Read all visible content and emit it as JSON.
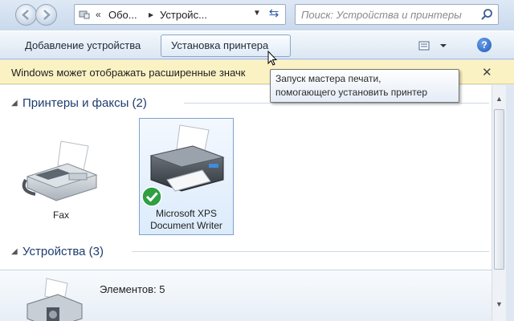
{
  "navigation": {
    "back_icon": "back-arrow-icon",
    "forward_icon": "forward-arrow-icon"
  },
  "address_bar": {
    "separator": "«",
    "crumb_1": "Обо...",
    "crumb_sep": "▶",
    "crumb_2": "Устройс...",
    "dropdown_icon": "chevron-down-icon",
    "refresh_icon": "refresh-icon"
  },
  "search": {
    "placeholder": "Поиск: Устройства и принтеры",
    "icon": "search-icon"
  },
  "toolbar": {
    "add_device_label": "Добавление устройства",
    "install_printer_label": "Установка принтера",
    "view_icon": "view-options-icon",
    "help_label": "?"
  },
  "infobar": {
    "message": "Windows может отображать расширенные значк",
    "close_label": "✕"
  },
  "tooltip": {
    "line_1": "Запуск мастера печати,",
    "line_2": "помогающего установить принтер"
  },
  "groups": [
    {
      "title": "Принтеры и факсы (2)",
      "devices": [
        {
          "label": "Fax",
          "icon": "fax-icon"
        },
        {
          "label_line_1": "Microsoft XPS",
          "label_line_2": "Document Writer",
          "icon": "printer-icon",
          "badge": "default-check-icon"
        }
      ]
    },
    {
      "title": "Устройства (3)"
    }
  ],
  "details": {
    "count_text": "Элементов: 5"
  },
  "colors": {
    "accent": "#1e3c6e",
    "infobar_bg": "#fbf2c4",
    "selection_border": "#7da2ce",
    "check_green": "#2ea043"
  }
}
